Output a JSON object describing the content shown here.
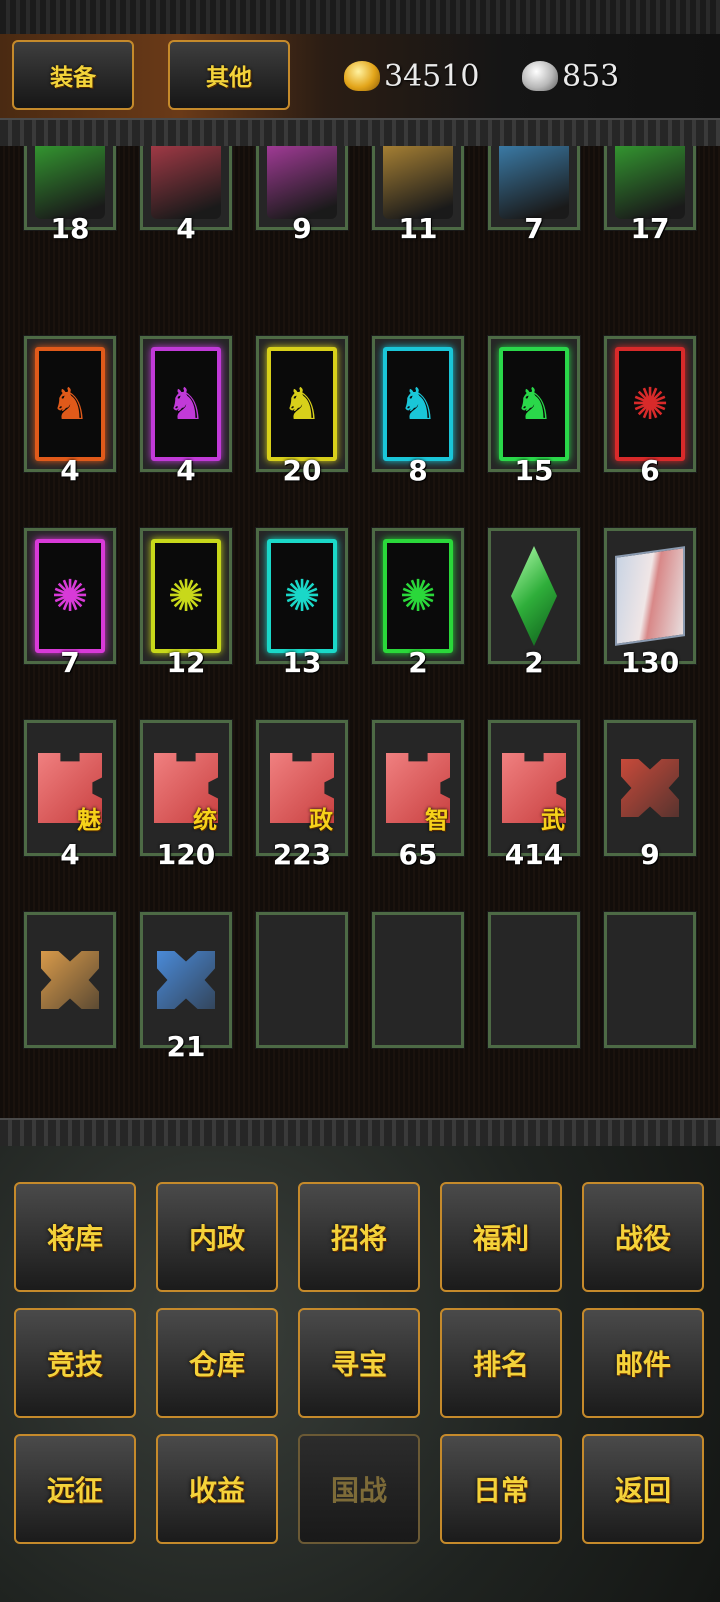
{
  "tabs": {
    "equip_label": "装备",
    "other_label": "其他"
  },
  "currency": {
    "gold": "34510",
    "silver": "853"
  },
  "inventory": {
    "rows": [
      [
        {
          "count": "18",
          "art": "scroll-green"
        },
        {
          "count": "4",
          "art": "scroll-red"
        },
        {
          "count": "9",
          "art": "scroll-pink"
        },
        {
          "count": "11",
          "art": "scroll-gold"
        },
        {
          "count": "7",
          "art": "scroll-blue"
        },
        {
          "count": "17",
          "art": "scroll-green"
        }
      ],
      [
        {
          "count": "4",
          "art": "horse-card-orange"
        },
        {
          "count": "4",
          "art": "horse-card-purple"
        },
        {
          "count": "20",
          "art": "horse-card-yellow"
        },
        {
          "count": "8",
          "art": "horse-card-cyan"
        },
        {
          "count": "15",
          "art": "horse-card-green"
        },
        {
          "count": "6",
          "art": "seal-card-red"
        }
      ],
      [
        {
          "count": "7",
          "art": "seal-card-magenta"
        },
        {
          "count": "12",
          "art": "seal-card-yellow"
        },
        {
          "count": "13",
          "art": "seal-card-cyan"
        },
        {
          "count": "2",
          "art": "seal-card-green"
        },
        {
          "count": "2",
          "art": "green-gem"
        },
        {
          "count": "130",
          "art": "open-book"
        }
      ],
      [
        {
          "count": "4",
          "art": "puzzle-piece",
          "tag": "魅"
        },
        {
          "count": "120",
          "art": "puzzle-piece",
          "tag": "统"
        },
        {
          "count": "223",
          "art": "puzzle-piece",
          "tag": "政"
        },
        {
          "count": "65",
          "art": "puzzle-piece",
          "tag": "智"
        },
        {
          "count": "414",
          "art": "puzzle-piece",
          "tag": "武"
        },
        {
          "count": "9",
          "art": "cross-piece-red"
        }
      ],
      [
        {
          "count": "",
          "art": "cross-piece-orange"
        },
        {
          "count": "21",
          "art": "cross-piece-blue"
        },
        {
          "count": "",
          "art": "empty"
        },
        {
          "count": "",
          "art": "empty"
        },
        {
          "count": "",
          "art": "empty"
        },
        {
          "count": "",
          "art": "empty"
        }
      ]
    ]
  },
  "menu": {
    "row1": [
      "将库",
      "内政",
      "招将",
      "福利",
      "战役"
    ],
    "row2": [
      "竞技",
      "仓库",
      "寻宝",
      "排名",
      "邮件"
    ],
    "row3": [
      "远征",
      "收益",
      "国战",
      "日常",
      "返回"
    ]
  },
  "colors": {
    "accent_gold": "#f4d23a",
    "slot_border": "#4d6a45",
    "button_border": "#c58a2b"
  }
}
